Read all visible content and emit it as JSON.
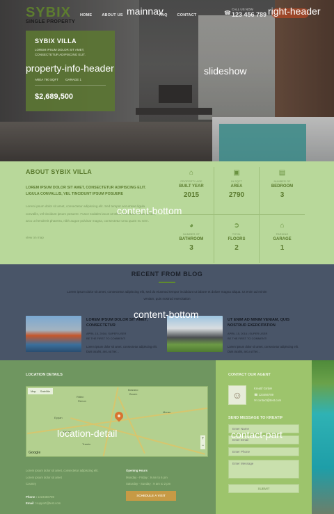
{
  "brand": {
    "name": "SYBIX",
    "tagline": "SINGLE PROPERTY"
  },
  "nav": {
    "items": [
      "HOME",
      "ABOUT US",
      "FAQ",
      "CONTACT"
    ]
  },
  "header": {
    "phone_label": "CALL US NOW",
    "phone_number": "123 456 789"
  },
  "property": {
    "title": "SYBIX VILLA",
    "subtitle": "LOREM IPSUM DOLOR SIT AMET, CONSECTETUR ADIPISCING ELIT.",
    "area": "AREA 790 SQFT",
    "garage": "GARAGE 1",
    "price": "$2,689,500"
  },
  "about": {
    "title": "ABOUT SYBIX VILLA",
    "lead": "LOREM IPSUM DOLOR SIT AMET, CONSECTETUR ADIPISCING ELIT. LIGULA CONVALLIS, VEL TINCIDUNT IPSUM POSUERE",
    "body": "Lorem ipsum dolor sit amet, consectetur adipiscing elit. Sed tempor accumsan ligula convallis, vel tincidunt ipsum posuere. Fusce sodales lacus ut tellus sollicitudin. Duis iaculis, arcu ut hendrerit pharetra, nibh augue pulvinar magna, consectetur urna quam eu sem.",
    "link": "view on map",
    "stats": [
      {
        "icon": "house-icon",
        "small": "PROPERTY AGE",
        "label": "BUILT YEAR",
        "value": "2015"
      },
      {
        "icon": "area-icon",
        "small": "IN SQFT",
        "label": "AREA",
        "value": "2790"
      },
      {
        "icon": "bed-icon",
        "small": "NUMBER OF",
        "label": "BEDROOM",
        "value": "3"
      },
      {
        "icon": "bath-icon",
        "small": "NUMBER OF",
        "label": "BATHROOM",
        "value": "3"
      },
      {
        "icon": "stairs-icon",
        "small": "TOTAL",
        "label": "FLOORS",
        "value": "2"
      },
      {
        "icon": "garage-icon",
        "small": "PARKING",
        "label": "GARAGE",
        "value": "1"
      }
    ]
  },
  "blog": {
    "title": "RECENT FROM BLOG",
    "subtitle": "Lorem ipsum dolor sit amet, consectetur adipiscing elit, sed do eiusmod tempor incididunt ut labore et dolore magna aliqua. Ut enim ad minim veniam, quis nostrud exercitation",
    "posts": [
      {
        "title": "LOREM IPSUM DOLOR SIT AMET, CONSECTETUR",
        "meta": "APRIL 15, 2016  |  SUPER USER",
        "comment": "BE THE FIRST TO COMMENT!",
        "excerpt": "Lorem ipsum dolor sit amet, consectetur adipiscing elit. Duis iaculis, arcu ut her..."
      },
      {
        "title": "UT ENIM AD MINIM VENIAM, QUIS NOSTRUD EXERCITATION",
        "meta": "APRIL 15, 2016  |  SUPER USER",
        "comment": "BE THE FIRST TO COMMENT!",
        "excerpt": "Lorem ipsum dolor sit amet, consectetur adipiscing elit. Duis iaculis, arcu ut her..."
      }
    ]
  },
  "location": {
    "title": "LOCATION DETAILS",
    "map_tabs": [
      "Map",
      "Satellite"
    ],
    "map_places": [
      "Bolzano",
      "Bozen",
      "Ritten",
      "Renon",
      "Eppan",
      "Kaltern",
      "Tramin",
      "Meran"
    ],
    "address": [
      "Lorem ipsum dolor sit amet, consectetur adipiscing elit.",
      "Lorem ipsum dolor sit amet",
      "Country"
    ],
    "hours_title": "Opening Hours",
    "hours": [
      "Monday - Friday : 9 am to 6 pm",
      "Saturday - Sunday : 9 am to 2 pm"
    ],
    "phone_label": "Phone :",
    "phone": "1223456789",
    "email_label": "Email :",
    "email": "support@test.com",
    "button": "SCHEDULE A VISIT"
  },
  "contact": {
    "title": "CONTACT OUR AGENT",
    "agent_name": "Kreatif GmbH",
    "agent_phone": "123456789",
    "agent_email": "contact@test.com",
    "form_title": "SEND MESSAGE TO KREATIF",
    "placeholders": {
      "name": "Enter Name",
      "email": "Enter Email",
      "phone": "Enter Phone",
      "message": "Enter Message"
    },
    "submit": "SUBMIT"
  },
  "overlay_labels": {
    "mainnav": "mainnav",
    "right_header": "right-header",
    "property_info": "property-info-header",
    "slideshow": "slideshow",
    "content_bottom_1": "content-bottom",
    "content_bottom_2": "content-bottom",
    "location_detail": "location-detail",
    "contact_part": "contact-part"
  },
  "colors": {
    "brand_green": "#5d7d2f",
    "about_bg": "#b8d89a",
    "blog_bg": "#495568",
    "location_bg": "#6f9660",
    "contact_bg": "#9dc46c",
    "accent_orange": "#c79a45"
  }
}
